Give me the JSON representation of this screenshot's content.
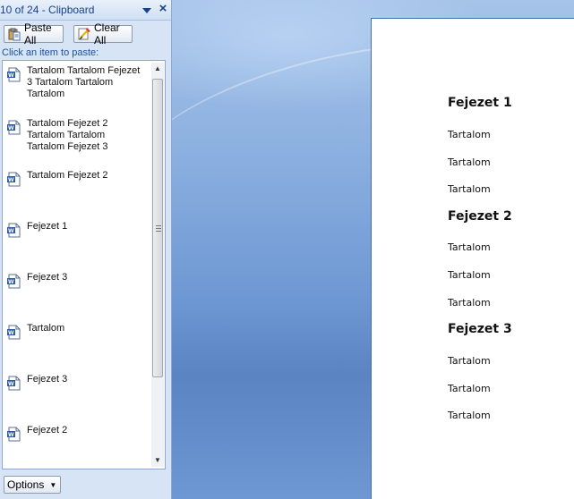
{
  "pane": {
    "title": "10 of 24 - Clipboard",
    "paste_all_label": "Paste All",
    "clear_all_label": "Clear All",
    "hint": "Click an item to paste:",
    "options_label": "Options",
    "items": [
      {
        "text": "Tartalom Tartalom Fejezet 3 Tartalom Tartalom Tartalom"
      },
      {
        "text": "Tartalom Fejezet 2 Tartalom Tartalom Tartalom Fejezet 3"
      },
      {
        "text": "Tartalom Fejezet 2"
      },
      {
        "text": "Fejezet 1"
      },
      {
        "text": "Fejezet 3"
      },
      {
        "text": "Tartalom"
      },
      {
        "text": "Fejezet 3"
      },
      {
        "text": "Fejezet 2"
      }
    ]
  },
  "document": {
    "lines": [
      {
        "text": "Fejezet 1",
        "style": "heading"
      },
      {
        "text": "Tartalom",
        "style": "body"
      },
      {
        "text": "Tartalom",
        "style": "body"
      },
      {
        "text": "Tartalom",
        "style": "body"
      },
      {
        "text": "Fejezet 2",
        "style": "heading"
      },
      {
        "text": "Tartalom",
        "style": "body"
      },
      {
        "text": "Tartalom",
        "style": "body"
      },
      {
        "text": "Tartalom",
        "style": "body"
      },
      {
        "text": "Fejezet 3",
        "style": "heading"
      },
      {
        "text": "Tartalom",
        "style": "body"
      },
      {
        "text": "Tartalom",
        "style": "body"
      },
      {
        "text": "Tartalom",
        "style": "body"
      }
    ]
  }
}
